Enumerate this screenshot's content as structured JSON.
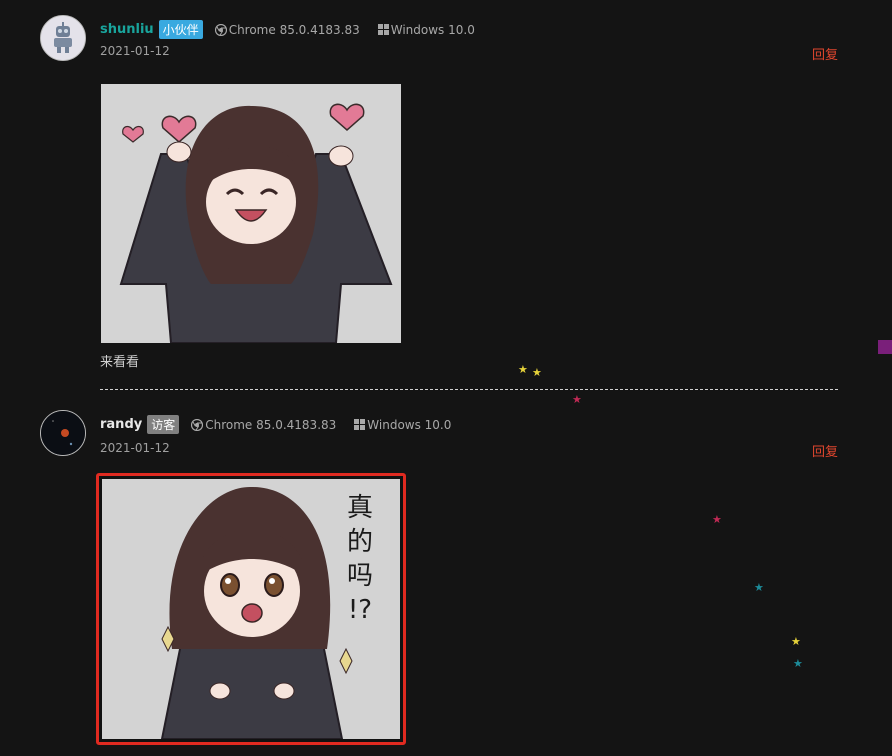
{
  "comments": [
    {
      "author": "shunliu",
      "author_color": "#19a49c",
      "badge": "小伙伴",
      "badge_color": "#39a9e0",
      "browser": "Chrome 85.0.4183.83",
      "os": "Windows 10.0",
      "date": "2021-01-12",
      "reply_label": "回复",
      "text": "来看看"
    },
    {
      "author": "randy",
      "author_color": "#e8e8e8",
      "badge": "访客",
      "badge_color": "#808080",
      "browser": "Chrome 85.0.4183.83",
      "os": "Windows 10.0",
      "date": "2021-01-12",
      "reply_label": "回复",
      "sticker_text": [
        "真",
        "的",
        "吗",
        "!?"
      ]
    }
  ],
  "colors": {
    "background": "#141414",
    "reply": "#e0462e",
    "highlight_border": "#e02a20",
    "star_yellow": "#e6d23a",
    "star_red": "#c02a55",
    "star_teal": "#1d8c9a"
  }
}
